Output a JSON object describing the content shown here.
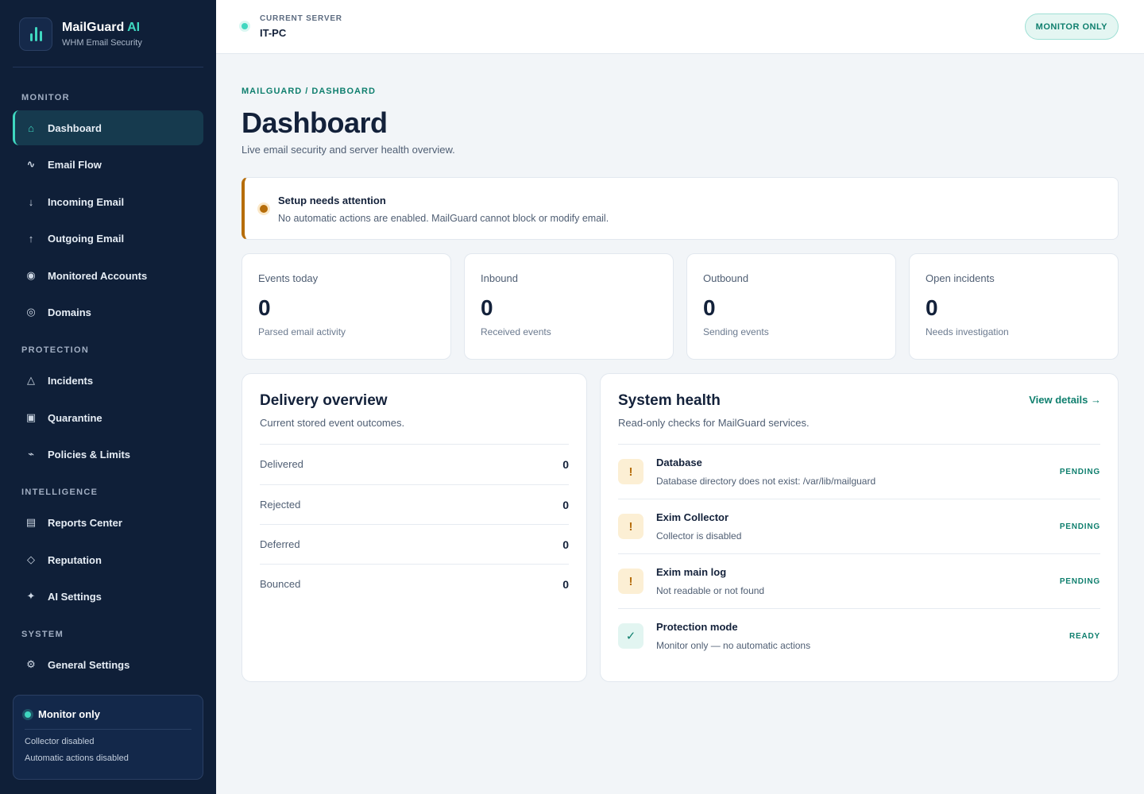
{
  "brand": {
    "title": "MailGuard",
    "title_accent": "AI",
    "subtitle": "WHM Email Security"
  },
  "nav": {
    "sections": [
      {
        "label": "MONITOR"
      },
      {
        "label": "PROTECTION"
      },
      {
        "label": "INTELLIGENCE"
      },
      {
        "label": "SYSTEM"
      }
    ],
    "items": [
      {
        "label": "Dashboard",
        "icon": "⌂",
        "icon_name": "home-icon",
        "active": true
      },
      {
        "label": "Email Flow",
        "icon": "∿",
        "icon_name": "wave-icon"
      },
      {
        "label": "Incoming Email",
        "icon": "↓",
        "icon_name": "arrow-down-icon"
      },
      {
        "label": "Outgoing Email",
        "icon": "↑",
        "icon_name": "arrow-up-icon"
      },
      {
        "label": "Monitored Accounts",
        "icon": "◉",
        "icon_name": "target-icon"
      },
      {
        "label": "Domains",
        "icon": "◎",
        "icon_name": "globe-icon"
      },
      {
        "label": "Incidents",
        "icon": "△",
        "icon_name": "warning-triangle-icon"
      },
      {
        "label": "Quarantine",
        "icon": "▣",
        "icon_name": "quarantine-box-icon"
      },
      {
        "label": "Policies & Limits",
        "icon": "⌁",
        "icon_name": "policy-icon"
      },
      {
        "label": "Reports Center",
        "icon": "▤",
        "icon_name": "report-icon"
      },
      {
        "label": "Reputation",
        "icon": "◇",
        "icon_name": "diamond-icon"
      },
      {
        "label": "AI Settings",
        "icon": "✦",
        "icon_name": "sparkle-icon"
      },
      {
        "label": "General Settings",
        "icon": "⚙",
        "icon_name": "gear-icon"
      }
    ]
  },
  "mode_card": {
    "title": "Monitor only",
    "line1": "Collector disabled",
    "line2": "Automatic actions disabled"
  },
  "topbar": {
    "server_label": "CURRENT SERVER",
    "server_name": "IT-PC",
    "mode_badge": "MONITOR ONLY"
  },
  "page": {
    "breadcrumb": "MAILGUARD / DASHBOARD",
    "title": "Dashboard",
    "subtitle": "Live email security and server health overview."
  },
  "alert": {
    "title": "Setup needs attention",
    "text": "No automatic actions are enabled. MailGuard cannot block or modify email."
  },
  "stats": [
    {
      "label": "Events today",
      "value": "0",
      "sub": "Parsed email activity"
    },
    {
      "label": "Inbound",
      "value": "0",
      "sub": "Received events"
    },
    {
      "label": "Outbound",
      "value": "0",
      "sub": "Sending events"
    },
    {
      "label": "Open incidents",
      "value": "0",
      "sub": "Needs investigation"
    }
  ],
  "delivery": {
    "title": "Delivery overview",
    "subtitle": "Current stored event outcomes.",
    "rows": [
      {
        "label": "Delivered",
        "value": "0"
      },
      {
        "label": "Rejected",
        "value": "0"
      },
      {
        "label": "Deferred",
        "value": "0"
      },
      {
        "label": "Bounced",
        "value": "0"
      }
    ]
  },
  "health": {
    "title": "System health",
    "subtitle": "Read-only checks for MailGuard services.",
    "link": "View details →",
    "rows": [
      {
        "name": "Database",
        "desc": "Database directory does not exist: /var/lib/mailguard",
        "status": "PENDING",
        "icon": "!",
        "kind": "warn"
      },
      {
        "name": "Exim Collector",
        "desc": "Collector is disabled",
        "status": "PENDING",
        "icon": "!",
        "kind": "warn"
      },
      {
        "name": "Exim main log",
        "desc": "Not readable or not found",
        "status": "PENDING",
        "icon": "!",
        "kind": "warn"
      },
      {
        "name": "Protection mode",
        "desc": "Monitor only — no automatic actions",
        "status": "READY",
        "icon": "✓",
        "kind": "ok"
      }
    ]
  },
  "colors": {
    "sidebar_bg": "#0f1f38",
    "accent": "#3fd7c0",
    "accent_dark": "#0f7f6e",
    "warning": "#b66d0a",
    "page_bg": "#f2f5f8"
  }
}
